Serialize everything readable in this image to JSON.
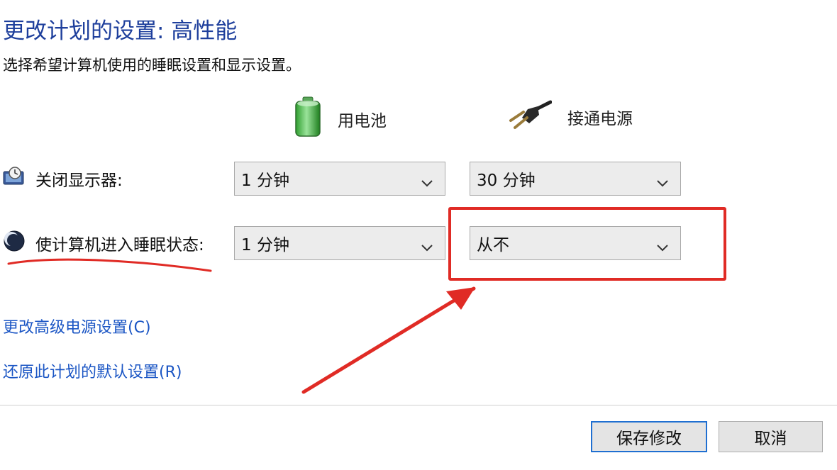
{
  "window": {
    "title": "更改计划的设置: 高性能",
    "subtitle": "选择希望计算机使用的睡眠设置和显示设置。"
  },
  "columns": {
    "battery": {
      "label": "用电池",
      "icon": "battery-icon"
    },
    "plugged_in": {
      "label": "接通电源",
      "icon": "power-plug-icon"
    }
  },
  "settings": {
    "display_off": {
      "label": "关闭显示器:",
      "icon": "monitor-clock-icon",
      "battery_value": "1 分钟",
      "plugged_value": "30 分钟"
    },
    "sleep": {
      "label": "使计算机进入睡眠状态:",
      "icon": "moon-icon",
      "battery_value": "1 分钟",
      "plugged_value": "从不"
    }
  },
  "links": {
    "advanced": "更改高级电源设置(C)",
    "restore": "还原此计划的默认设置(R)"
  },
  "buttons": {
    "save": "保存修改",
    "cancel": "取消"
  },
  "annotations": {
    "highlight_color": "#e02b25"
  },
  "colors": {
    "title": "#1e3f9c",
    "link": "#1a55c4",
    "focus_border": "#1f6fd1"
  }
}
